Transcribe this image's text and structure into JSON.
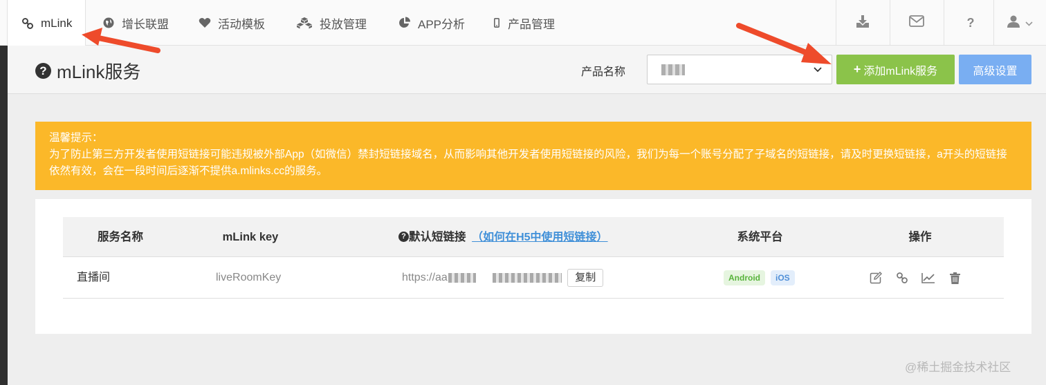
{
  "nav": {
    "items": [
      {
        "label": "mLink",
        "icon": "link-icon"
      },
      {
        "label": "增长联盟",
        "icon": "globe-icon"
      },
      {
        "label": "活动模板",
        "icon": "heart-icon"
      },
      {
        "label": "投放管理",
        "icon": "cubes-icon"
      },
      {
        "label": "APP分析",
        "icon": "pie-chart-icon"
      },
      {
        "label": "产品管理",
        "icon": "mobile-icon"
      }
    ],
    "right_icons": [
      "download-icon",
      "envelope-icon",
      "question-icon",
      "user-icon"
    ]
  },
  "header": {
    "title": "mLink服务",
    "product_label": "产品名称",
    "add_button": "添加mLink服务",
    "advanced_button": "高级设置"
  },
  "warning": {
    "title": "温馨提示：",
    "body": "为了防止第三方开发者使用短链接可能违规被外部App（如微信）禁封短链接域名，从而影响其他开发者使用短链接的风险，我们为每一个账号分配了子域名的短链接，请及时更换短链接，a开头的短链接依然有效，会在一段时间后逐渐不提供a.mlinks.cc的服务。"
  },
  "table": {
    "headers": {
      "name": "服务名称",
      "key": "mLink key",
      "short_link": "默认短链接",
      "help_link": "（如何在H5中使用短链接）",
      "platform": "系统平台",
      "actions": "操作"
    },
    "rows": [
      {
        "name": "直播间",
        "key": "liveRoomKey",
        "url_prefix": "https://aa",
        "copy_label": "复制",
        "platforms": [
          "Android",
          "iOS"
        ]
      }
    ],
    "actions_icons": [
      "edit-icon",
      "link-icon",
      "line-chart-icon",
      "trash-icon"
    ]
  },
  "watermark": "@稀土掘金技术社区",
  "colors": {
    "add_button": "#8bc34a",
    "advanced_button": "#79aef2",
    "warning": "#fbb829",
    "arrow": "#ee4b2b"
  }
}
